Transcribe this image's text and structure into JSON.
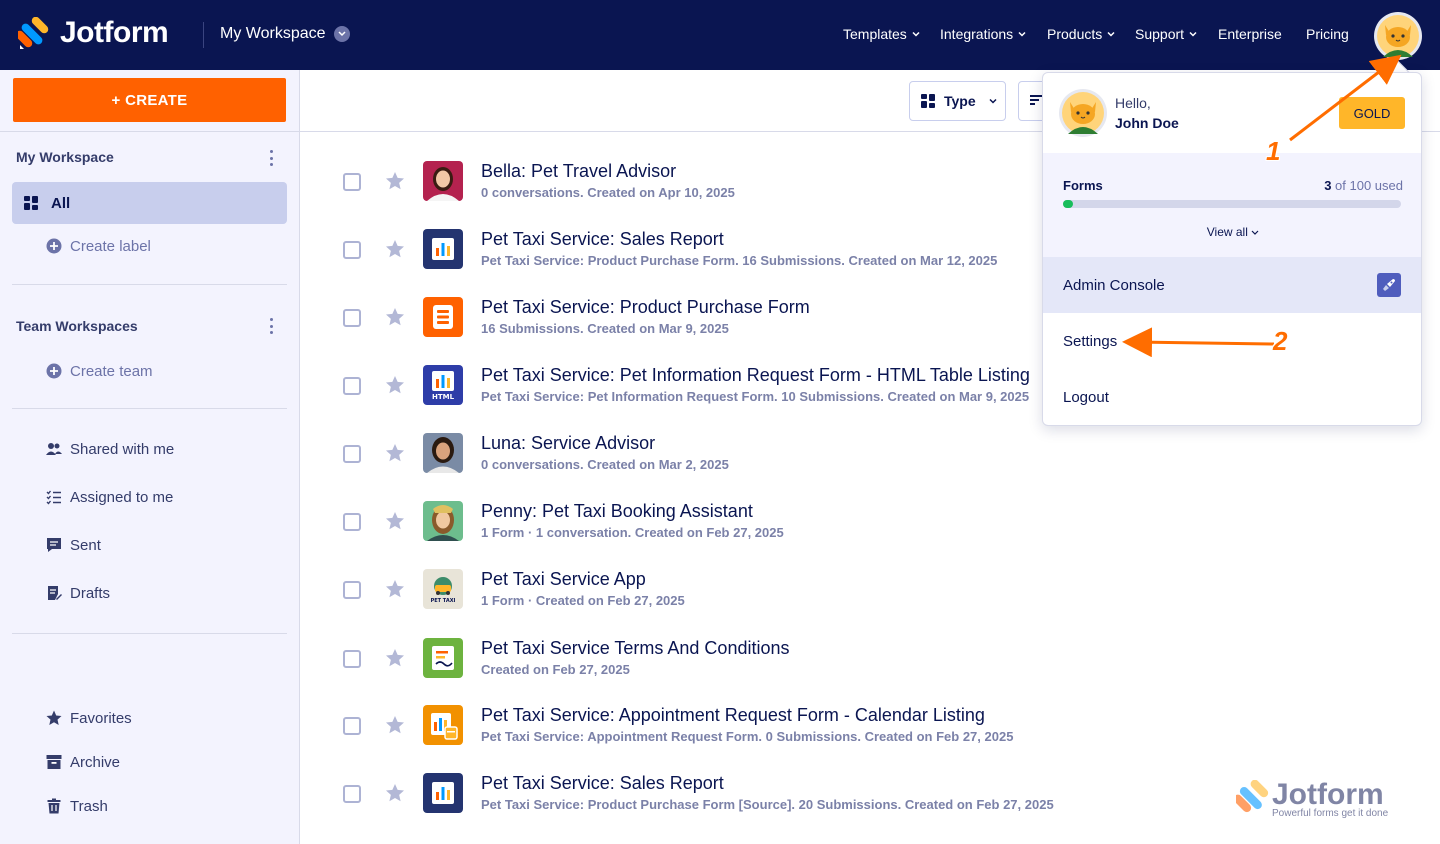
{
  "app": {
    "brand": "Jotform",
    "workspace": "My Workspace"
  },
  "topnav": [
    {
      "label": "Templates",
      "dropdown": true
    },
    {
      "label": "Integrations",
      "dropdown": true
    },
    {
      "label": "Products",
      "dropdown": true
    },
    {
      "label": "Support",
      "dropdown": true
    },
    {
      "label": "Enterprise",
      "dropdown": false
    },
    {
      "label": "Pricing",
      "dropdown": false
    }
  ],
  "sidebar": {
    "create_label": "+ CREATE",
    "my_workspace_heading": "My Workspace",
    "all_label": "All",
    "create_label_link": "Create label",
    "team_workspaces_heading": "Team Workspaces",
    "create_team_link": "Create team",
    "shared_with_me": "Shared with me",
    "assigned_to_me": "Assigned to me",
    "sent": "Sent",
    "drafts": "Drafts",
    "favorites": "Favorites",
    "archive": "Archive",
    "trash": "Trash"
  },
  "toolbar": {
    "type_label": "Type"
  },
  "items": [
    {
      "title": "Bella: Pet Travel Advisor",
      "subtitle": "0 conversations. Created on Apr 10, 2025",
      "thumb": "avatar-woman"
    },
    {
      "title": "Pet Taxi Service: Sales Report",
      "subtitle": "Pet Taxi Service: Product Purchase Form. 16 Submissions. Created on Mar 12, 2025",
      "thumb": "report"
    },
    {
      "title": "Pet Taxi Service: Product Purchase Form",
      "subtitle": "16 Submissions. Created on Mar 9, 2025",
      "thumb": "form"
    },
    {
      "title": "Pet Taxi Service: Pet Information Request Form - HTML Table Listing",
      "subtitle": "Pet Taxi Service: Pet Information Request Form. 10 Submissions. Created on Mar 9, 2025",
      "thumb": "html",
      "thumb_text": "HTML"
    },
    {
      "title": "Luna: Service Advisor",
      "subtitle": "0 conversations. Created on Mar 2, 2025",
      "thumb": "avatar-woman2"
    },
    {
      "title": "Penny: Pet Taxi Booking Assistant",
      "subtitle": "1 Form · 1 conversation. Created on Feb 27, 2025",
      "thumb": "avatar-woman3"
    },
    {
      "title": "Pet Taxi Service App",
      "subtitle": "1 Form · Created on Feb 27, 2025",
      "thumb": "app",
      "thumb_text": "PET TAXI"
    },
    {
      "title": "Pet Taxi Service Terms And Conditions",
      "subtitle": "Created on Feb 27, 2025",
      "thumb": "sign"
    },
    {
      "title": "Pet Taxi Service: Appointment Request Form - Calendar Listing",
      "subtitle": "Pet Taxi Service: Appointment Request Form. 0 Submissions. Created on Feb 27, 2025",
      "thumb": "calendar"
    },
    {
      "title": "Pet Taxi Service: Sales Report",
      "subtitle": "Pet Taxi Service: Product Purchase Form [Source]. 20 Submissions. Created on Feb 27, 2025",
      "thumb": "report"
    }
  ],
  "account_menu": {
    "hello": "Hello,",
    "name": "John Doe",
    "plan_badge": "GOLD",
    "usage_label": "Forms",
    "usage_used": "3",
    "usage_rest": " of 100 used",
    "usage_fraction": 0.03,
    "view_all": "View all",
    "admin_console": "Admin Console",
    "settings": "Settings",
    "logout": "Logout"
  },
  "annotations": {
    "step1": "1",
    "step2": "2"
  },
  "watermark": {
    "brand": "Jotform",
    "tagline": "Powerful forms get it done"
  },
  "colors": {
    "navy": "#0a1551",
    "orange": "#ff6100",
    "gold": "#ffb629",
    "green": "#18bd5b",
    "active_bg": "#c8ceed"
  }
}
